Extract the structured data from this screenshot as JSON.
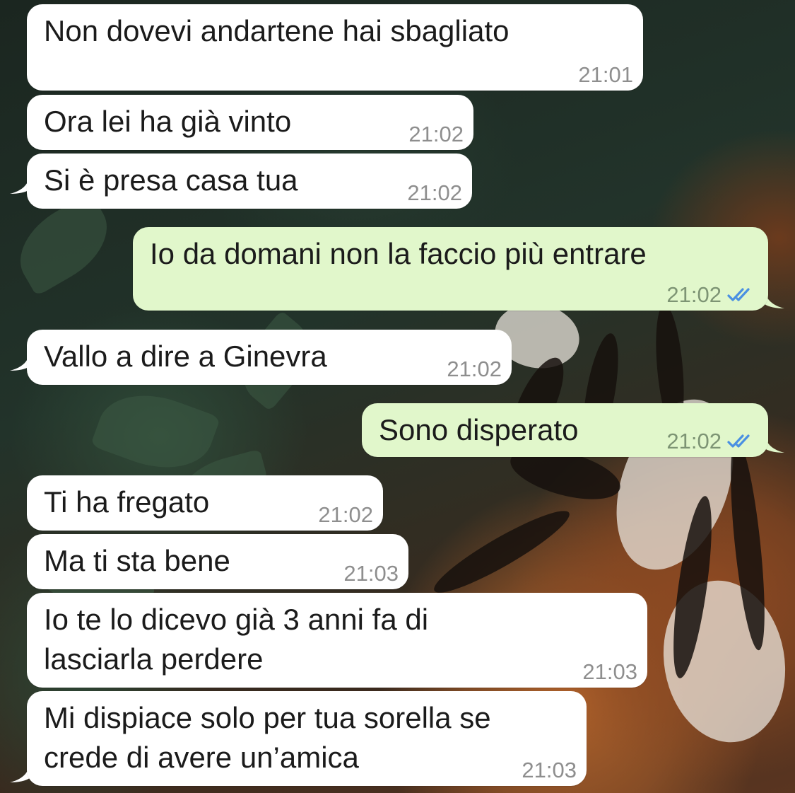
{
  "chat": {
    "messages": [
      {
        "direction": "incoming",
        "text": "Non dovevi andartene hai sbagliato",
        "time": "21:01"
      },
      {
        "direction": "incoming",
        "text": "Ora lei ha già vinto",
        "time": "21:02"
      },
      {
        "direction": "incoming",
        "text": "Si è presa casa tua",
        "time": "21:02"
      },
      {
        "direction": "outgoing",
        "text": "Io da domani non la faccio più entrare",
        "time": "21:02",
        "status": "read"
      },
      {
        "direction": "incoming",
        "text": "Vallo a dire a Ginevra",
        "time": "21:02"
      },
      {
        "direction": "outgoing",
        "text": "Sono disperato",
        "time": "21:02",
        "status": "read"
      },
      {
        "direction": "incoming",
        "text": "Ti ha fregato",
        "time": "21:02"
      },
      {
        "direction": "incoming",
        "text": "Ma ti sta bene",
        "time": "21:03"
      },
      {
        "direction": "incoming",
        "text": "Io te lo dicevo già 3 anni fa di\nlasciarla perdere",
        "time": "21:03"
      },
      {
        "direction": "incoming",
        "text": "Mi dispiace solo per tua sorella se\ncrede di avere un’amica",
        "time": "21:03"
      }
    ]
  },
  "icons": {
    "read_receipt": "double-check-icon"
  },
  "colors": {
    "incoming_bubble": "#ffffff",
    "outgoing_bubble": "#e1f7cb",
    "read_tick": "#4a90e2",
    "timestamp": "#8e8e8e"
  }
}
